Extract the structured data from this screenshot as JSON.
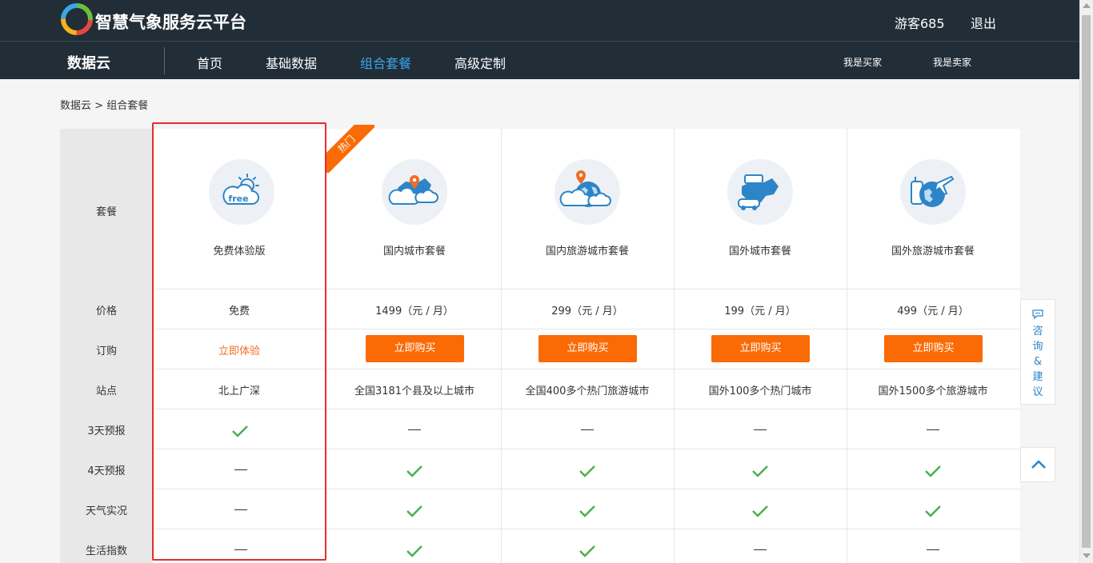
{
  "header": {
    "site_name": "智慧气象服务云平台",
    "user": "游客685",
    "logout": "退出"
  },
  "nav": {
    "brand": "数据云",
    "items": [
      {
        "label": "首页",
        "active": false
      },
      {
        "label": "基础数据",
        "active": false
      },
      {
        "label": "组合套餐",
        "active": true
      },
      {
        "label": "高级定制",
        "active": false
      }
    ],
    "buyer": "我是买家",
    "seller": "我是卖家"
  },
  "breadcrumb": {
    "root": "数据云",
    "sep": " > ",
    "current": "组合套餐"
  },
  "table": {
    "row_labels": [
      "套餐",
      "价格",
      "订购",
      "站点",
      "3天预报",
      "4天预报",
      "天气实况",
      "生活指数"
    ],
    "hot_label": "热门",
    "packages": [
      {
        "name": "免费体验版",
        "icon": "free-weather-icon",
        "price": "免费",
        "order": "立即体验",
        "stations": "北上广深",
        "features": [
          true,
          false,
          false,
          false
        ]
      },
      {
        "name": "国内城市套餐",
        "icon": "china-map-pin-icon",
        "price": "1499（元 / 月）",
        "order": "立即购买",
        "stations": "全国3181个县及以上城市",
        "features": [
          false,
          true,
          true,
          true
        ]
      },
      {
        "name": "国内旅游城市套餐",
        "icon": "globe-pin-icon",
        "price": "299（元 / 月）",
        "order": "立即购买",
        "stations": "全国400多个热门旅游城市",
        "features": [
          false,
          true,
          true,
          true
        ]
      },
      {
        "name": "国外城市套餐",
        "icon": "car-map-icon",
        "price": "199（元 / 月）",
        "order": "立即购买",
        "stations": "国外100多个热门城市",
        "features": [
          false,
          true,
          true,
          false
        ]
      },
      {
        "name": "国外旅游城市套餐",
        "icon": "luggage-plane-icon",
        "price": "499（元 / 月）",
        "order": "立即购买",
        "stations": "国外1500多个旅游城市",
        "features": [
          false,
          true,
          true,
          false
        ]
      }
    ]
  },
  "sidebar": {
    "consult": "咨\n询\n&\n建\n议"
  },
  "colors": {
    "header_bg": "#212d37",
    "accent_orange": "#fa6a05",
    "active_nav": "#3aa6e8",
    "check_green": "#4caf50",
    "highlight_red": "#e52d2d"
  }
}
